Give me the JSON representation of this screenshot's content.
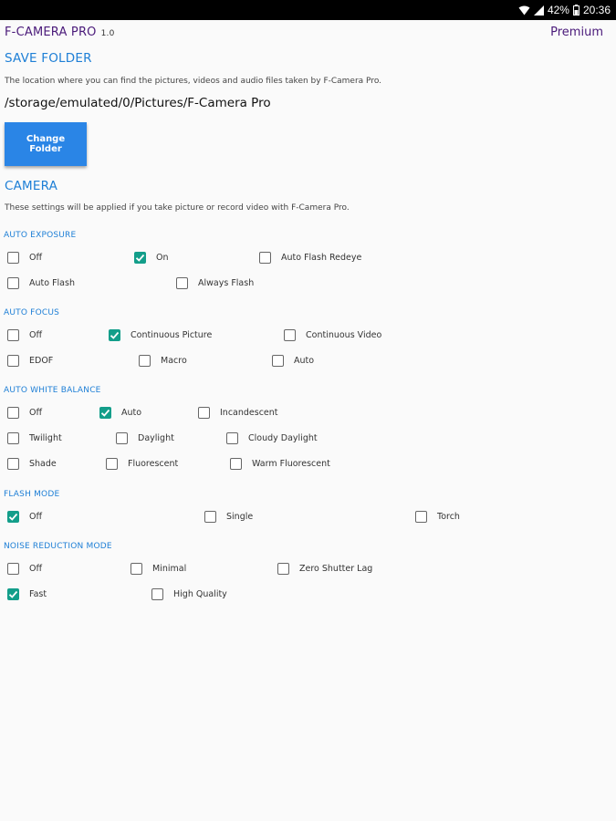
{
  "status": {
    "battery": "42%",
    "time": "20:36"
  },
  "header": {
    "app_name": "F-CAMERA PRO",
    "version": "1.0",
    "premium_label": "Premium"
  },
  "save_folder": {
    "title": "SAVE FOLDER",
    "description": "The location where you can find the pictures, videos and audio files taken by F-Camera Pro.",
    "path": "/storage/emulated/0/Pictures/F-Camera Pro",
    "button_label": "Change Folder"
  },
  "camera": {
    "title": "CAMERA",
    "description": "These settings will be applied if you take picture or record video with F-Camera Pro."
  },
  "groups": {
    "auto_exposure": {
      "title": "AUTO EXPOSURE",
      "options": [
        {
          "label": "Off",
          "checked": false
        },
        {
          "label": "On",
          "checked": true
        },
        {
          "label": "Auto Flash Redeye",
          "checked": false
        },
        {
          "label": "Auto Flash",
          "checked": false
        },
        {
          "label": "Always Flash",
          "checked": false
        }
      ]
    },
    "auto_focus": {
      "title": "AUTO FOCUS",
      "options": [
        {
          "label": "Off",
          "checked": false
        },
        {
          "label": "Continuous Picture",
          "checked": true
        },
        {
          "label": "Continuous Video",
          "checked": false
        },
        {
          "label": "EDOF",
          "checked": false
        },
        {
          "label": "Macro",
          "checked": false
        },
        {
          "label": "Auto",
          "checked": false
        }
      ]
    },
    "auto_white_balance": {
      "title": "AUTO WHITE BALANCE",
      "options": [
        {
          "label": "Off",
          "checked": false
        },
        {
          "label": "Auto",
          "checked": true
        },
        {
          "label": "Incandescent",
          "checked": false
        },
        {
          "label": "Twilight",
          "checked": false
        },
        {
          "label": "Daylight",
          "checked": false
        },
        {
          "label": "Cloudy Daylight",
          "checked": false
        },
        {
          "label": "Shade",
          "checked": false
        },
        {
          "label": "Fluorescent",
          "checked": false
        },
        {
          "label": "Warm Fluorescent",
          "checked": false
        }
      ]
    },
    "flash_mode": {
      "title": "FLASH MODE",
      "options": [
        {
          "label": "Off",
          "checked": true
        },
        {
          "label": "Single",
          "checked": false
        },
        {
          "label": "Torch",
          "checked": false
        }
      ]
    },
    "noise_reduction_mode": {
      "title": "NOISE REDUCTION MODE",
      "options": [
        {
          "label": "Off",
          "checked": false
        },
        {
          "label": "Minimal",
          "checked": false
        },
        {
          "label": "Zero Shutter Lag",
          "checked": false
        },
        {
          "label": "Fast",
          "checked": true
        },
        {
          "label": "High Quality",
          "checked": false
        }
      ]
    }
  },
  "colors": {
    "accent_blue": "#1e7fd6",
    "check_teal": "#139e8a",
    "title_purple": "#4a1a7a",
    "button_blue": "#2a85e6"
  }
}
